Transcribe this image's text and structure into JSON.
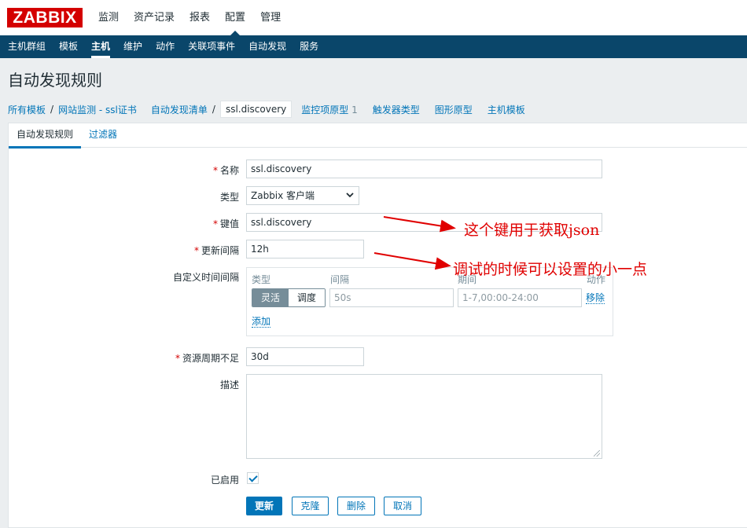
{
  "logo": "ZABBIX",
  "main_menu": [
    "监测",
    "资产记录",
    "报表",
    "配置",
    "管理"
  ],
  "sub_menu": [
    "主机群组",
    "模板",
    "主机",
    "维护",
    "动作",
    "关联项事件",
    "自动发现",
    "服务"
  ],
  "page_title": "自动发现规则",
  "breadcrumbs": {
    "all_templates": "所有模板",
    "template": "网站监测 - ssl证书",
    "discovery_list": "自动发现清单",
    "current": "ssl.discovery"
  },
  "nav_tabs": {
    "item_prototypes": "监控项原型",
    "item_prototypes_count": "1",
    "trigger_types": "触发器类型",
    "graph_prototypes": "图形原型",
    "host_templates": "主机模板"
  },
  "form_tabs": [
    "自动发现规则",
    "过滤器"
  ],
  "form": {
    "name_label": "名称",
    "name_value": "ssl.discovery",
    "type_label": "类型",
    "type_value": "Zabbix 客户端",
    "key_label": "键值",
    "key_value": "ssl.discovery",
    "interval_label": "更新间隔",
    "interval_value": "12h",
    "custom_label": "自定义时间间隔",
    "custom": {
      "col_type": "类型",
      "col_interval": "间隔",
      "col_period": "期间",
      "col_action": "动作",
      "flexible": "灵活",
      "scheduling": "调度",
      "interval_placeholder": "50s",
      "period_placeholder": "1-7,00:00-24:00",
      "remove": "移除",
      "add": "添加"
    },
    "lifetime_label": "资源周期不足",
    "lifetime_value": "30d",
    "description_label": "描述",
    "enabled_label": "已启用",
    "enabled": true
  },
  "buttons": {
    "update": "更新",
    "clone": "克隆",
    "delete": "删除",
    "cancel": "取消"
  },
  "annotations": {
    "key_note": "这个键用于获取json",
    "interval_note": "调试的时候可以设置的小一点"
  },
  "colors": {
    "brand_red": "#d40000",
    "nav_blue": "#0a466a",
    "link_blue": "#0275b8",
    "annotation_red": "#e00000"
  }
}
